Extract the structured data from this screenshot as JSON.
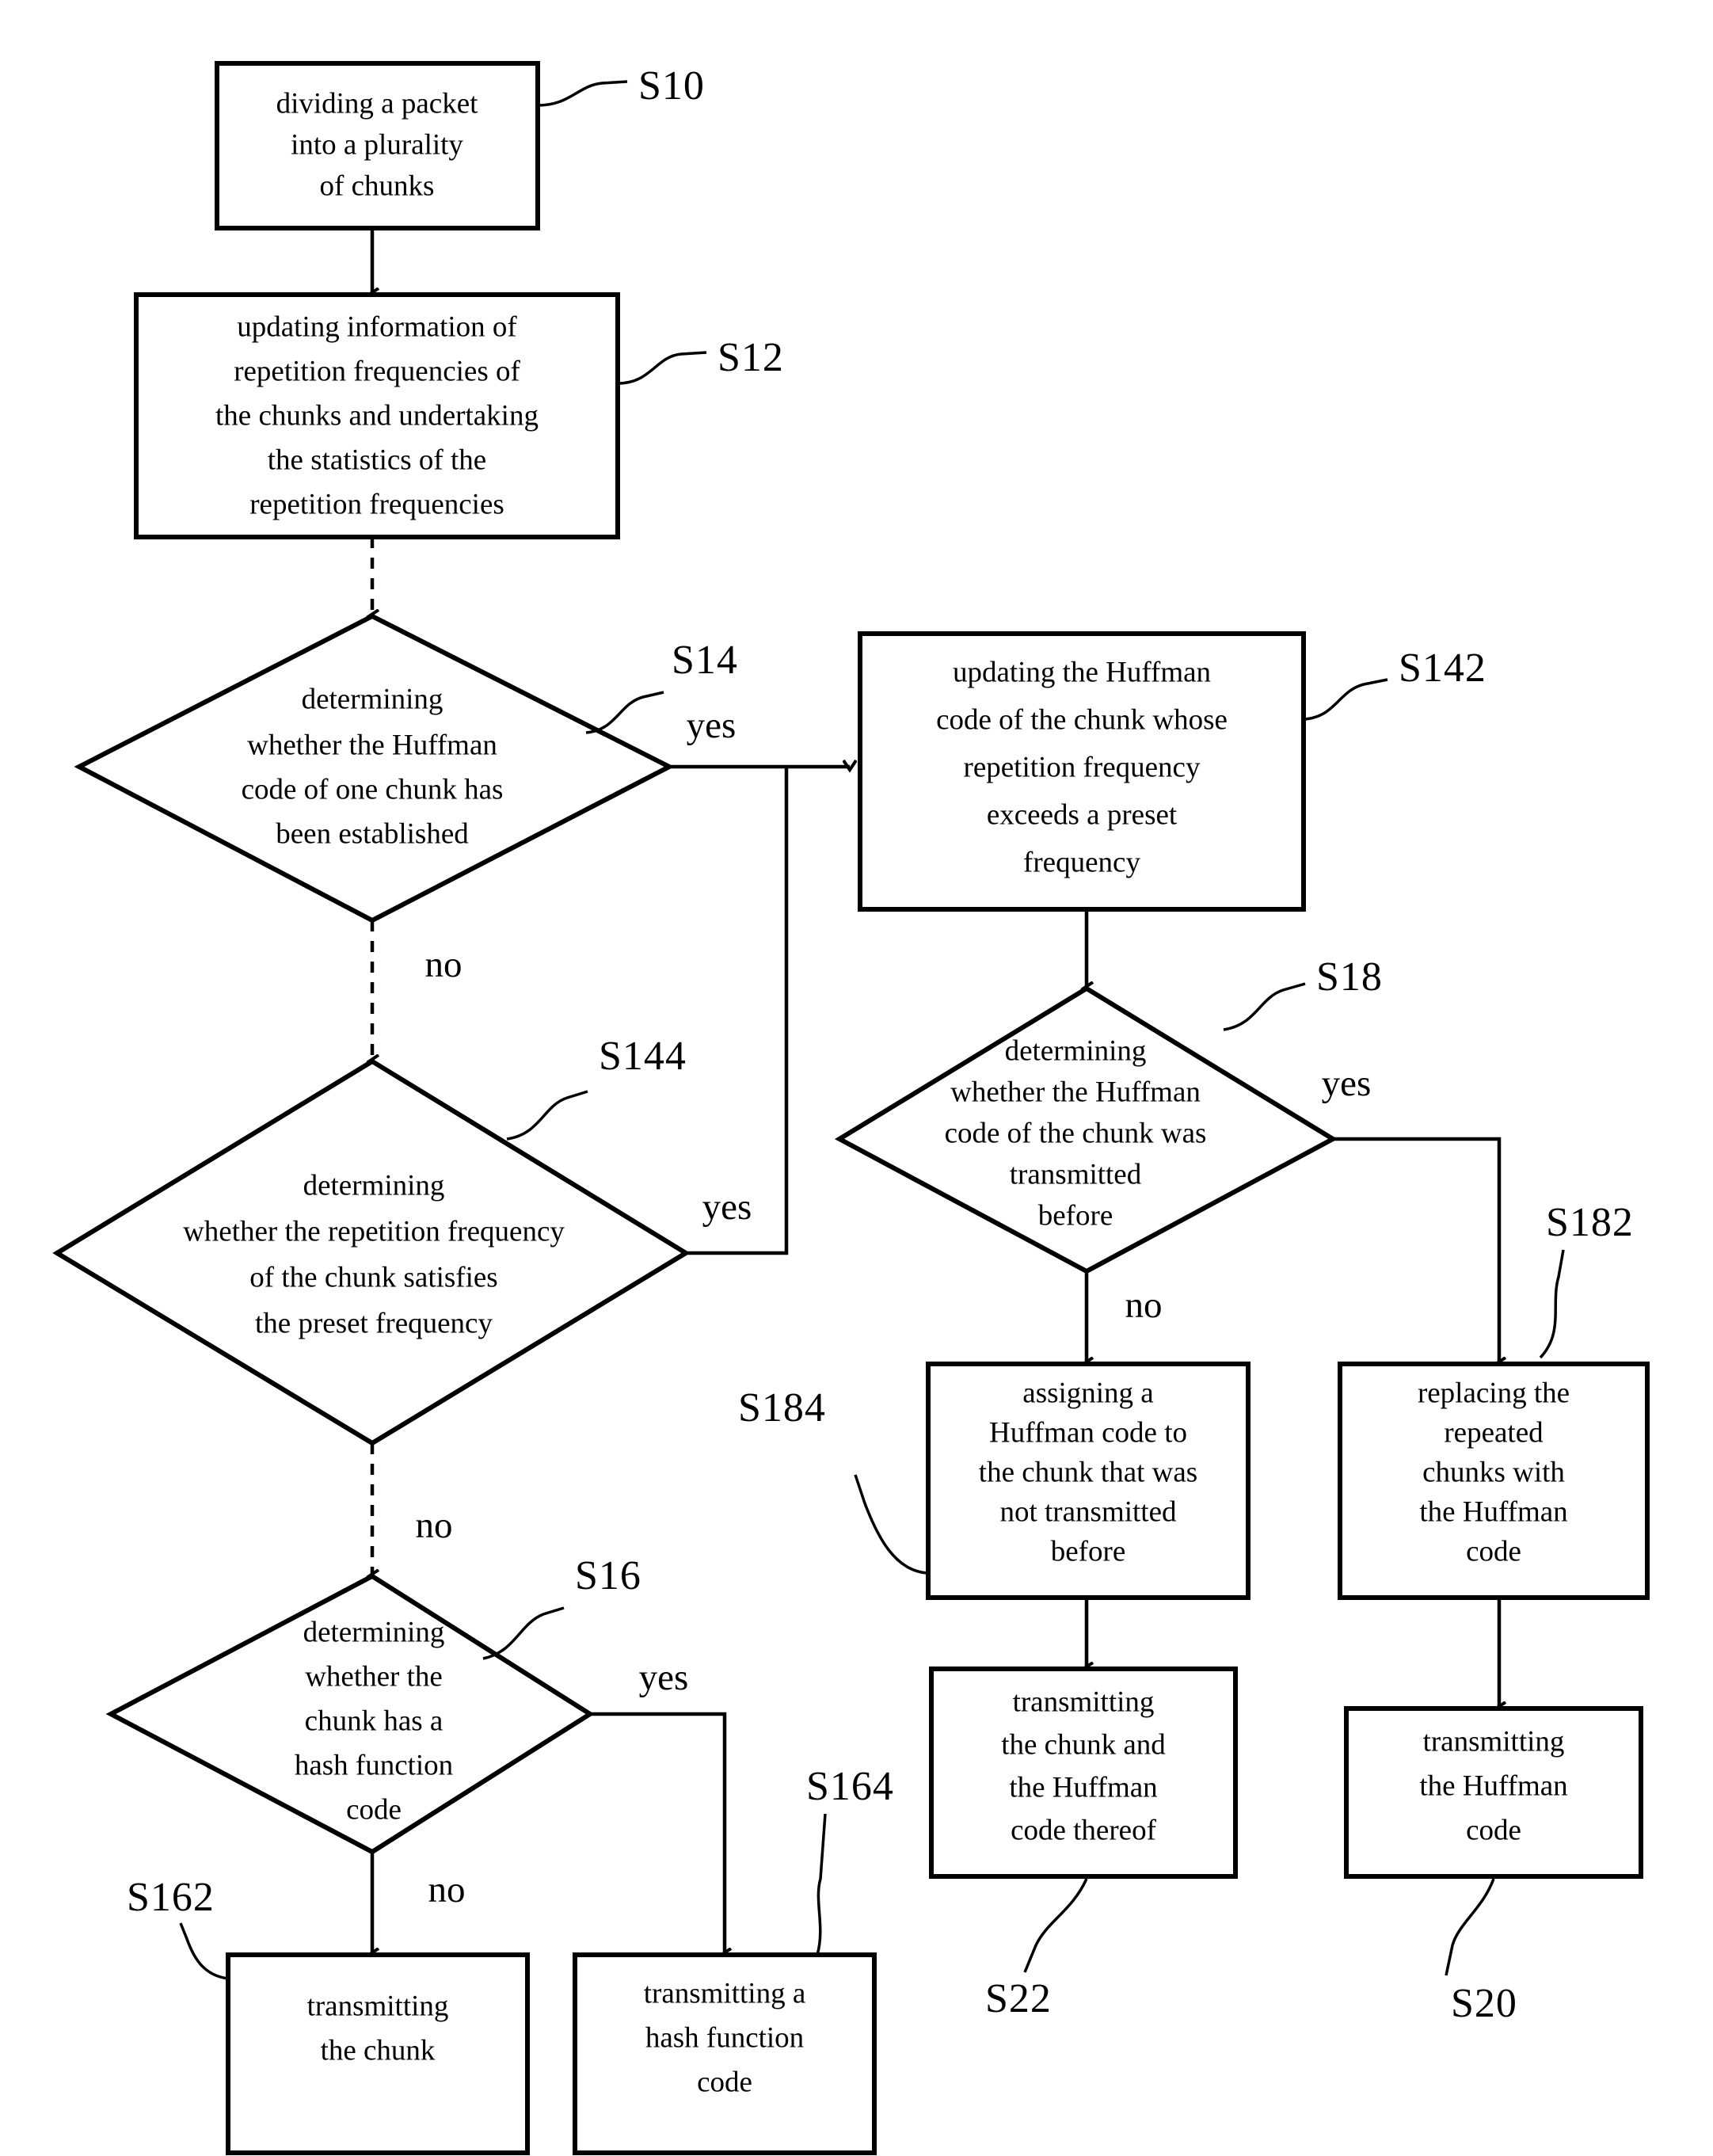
{
  "diagram": {
    "type": "flowchart",
    "title": "",
    "nodes": [
      {
        "id": "S10",
        "ref": "S10",
        "shape": "process",
        "lines": [
          "dividing a packet",
          "into a plurality",
          "of chunks"
        ]
      },
      {
        "id": "S12",
        "ref": "S12",
        "shape": "process",
        "lines": [
          "updating information of",
          "repetition frequencies of",
          "the chunks and undertaking",
          "the statistics of the",
          "repetition frequencies"
        ]
      },
      {
        "id": "S14",
        "ref": "S14",
        "shape": "decision",
        "lines": [
          "determining",
          "whether the Huffman",
          "code of one chunk has",
          "been established"
        ]
      },
      {
        "id": "S142",
        "ref": "S142",
        "shape": "process",
        "lines": [
          "updating the Huffman",
          "code of the chunk whose",
          "repetition frequency",
          "exceeds a preset",
          "frequency"
        ]
      },
      {
        "id": "S144",
        "ref": "S144",
        "shape": "decision",
        "lines": [
          "determining",
          "whether the repetition frequency",
          "of the chunk satisfies",
          "the preset frequency"
        ]
      },
      {
        "id": "S18",
        "ref": "S18",
        "shape": "decision",
        "lines": [
          "determining",
          "whether the Huffman",
          "code of the chunk was",
          "transmitted",
          "before"
        ]
      },
      {
        "id": "S16",
        "ref": "S16",
        "shape": "decision",
        "lines": [
          "determining",
          "whether the",
          "chunk has a",
          "hash function",
          "code"
        ]
      },
      {
        "id": "S184",
        "ref": "S184",
        "shape": "process",
        "lines": [
          "assigning a",
          "Huffman code to",
          "the chunk that was",
          "not transmitted",
          "before"
        ]
      },
      {
        "id": "S182",
        "ref": "S182",
        "shape": "process",
        "lines": [
          "replacing the",
          "repeated",
          "chunks with",
          "the Huffman",
          "code"
        ]
      },
      {
        "id": "S162",
        "ref": "S162",
        "shape": "process",
        "lines": [
          "transmitting",
          "the chunk"
        ]
      },
      {
        "id": "S164",
        "ref": "S164",
        "shape": "process",
        "lines": [
          "transmitting a",
          "hash function",
          "code"
        ]
      },
      {
        "id": "S22",
        "ref": "S22",
        "shape": "process",
        "lines": [
          "transmitting",
          "the chunk and",
          "the Huffman",
          "code thereof"
        ]
      },
      {
        "id": "S20",
        "ref": "S20",
        "shape": "process",
        "lines": [
          "transmitting",
          "the Huffman",
          "code"
        ]
      }
    ],
    "branch_labels": {
      "s14_yes": "yes",
      "s14_no": "no",
      "s144_yes": "yes",
      "s144_no": "no",
      "s16_yes": "yes",
      "s16_no": "no",
      "s18_yes": "yes",
      "s18_no": "no"
    },
    "colors": {
      "stroke": "#000000",
      "fill": "#ffffff",
      "background": "#ffffff"
    }
  }
}
